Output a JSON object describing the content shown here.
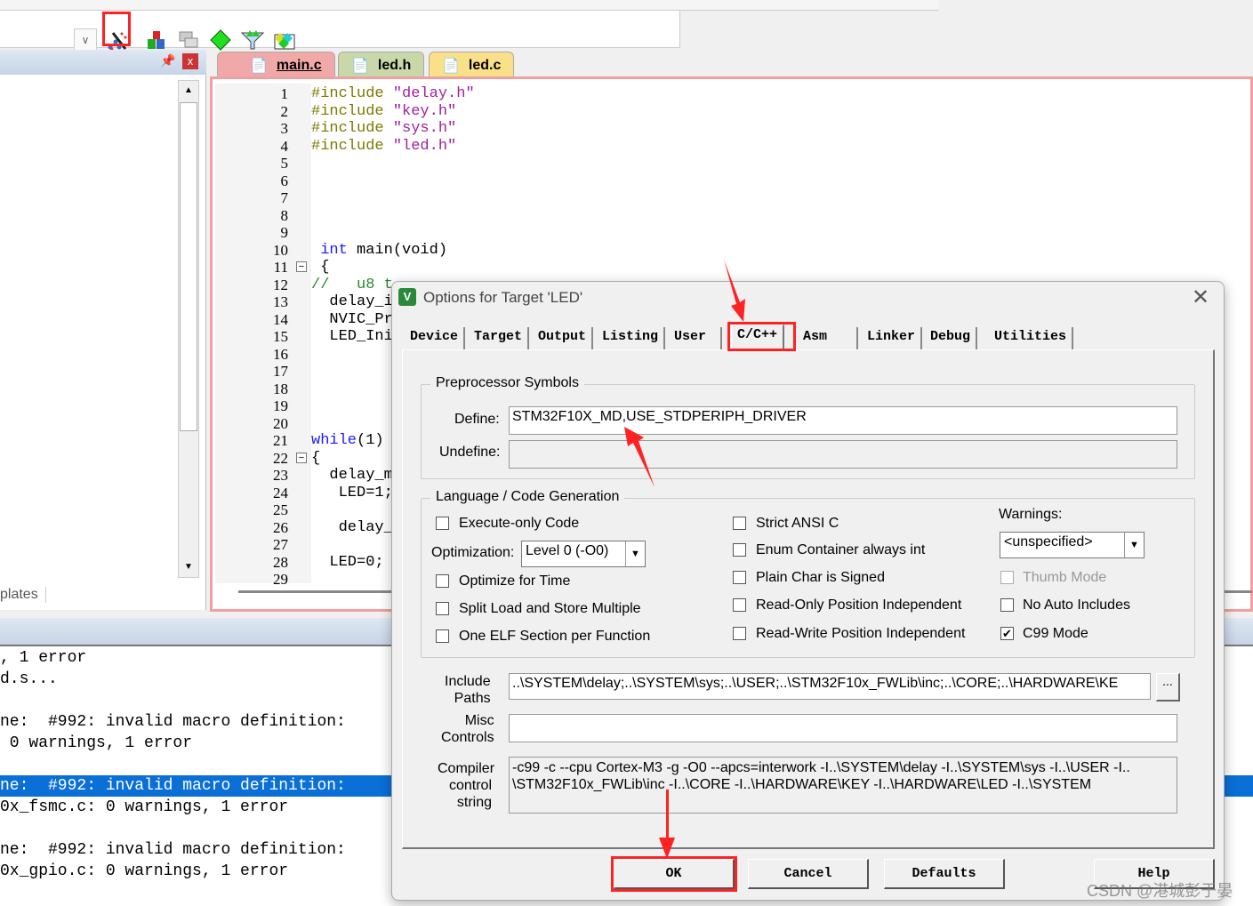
{
  "toolbar": {
    "icons": [
      "dropdown-chevron-icon",
      "options-for-target-icon",
      "manage-project-items-icon",
      "select-packs-icon",
      "pack-installer-icon",
      "run-time-environment-icon",
      "event-recorder-icon"
    ]
  },
  "left_pane": {
    "tab_label": "plates"
  },
  "file_tabs": [
    {
      "label": "main.c",
      "color": "#f1a8a8"
    },
    {
      "label": "led.h",
      "color": "#c8d8a8"
    },
    {
      "label": "led.c",
      "color": "#fbe08a"
    }
  ],
  "code": {
    "line_numbers": [
      "1",
      "2",
      "3",
      "4",
      "5",
      "6",
      "7",
      "8",
      "9",
      "10",
      "11",
      "12",
      "13",
      "14",
      "15",
      "16",
      "17",
      "18",
      "19",
      "20",
      "21",
      "22",
      "23",
      "24",
      "25",
      "26",
      "27",
      "28",
      "29"
    ],
    "lines": [
      {
        "n": 1,
        "kw": "#include ",
        "str": "\"delay.h\""
      },
      {
        "n": 2,
        "kw": "#include ",
        "str": "\"key.h\""
      },
      {
        "n": 3,
        "kw": "#include ",
        "str": "\"sys.h\""
      },
      {
        "n": 4,
        "kw": "#include ",
        "str": "\"led.h\""
      },
      {
        "n": 10,
        "kw": " int",
        "str": "",
        "rest": " main(void)"
      },
      {
        "n": 11,
        "rest": " {"
      },
      {
        "n": 12,
        "cm": "//   u8 t"
      },
      {
        "n": 13,
        "rest": "  delay_i"
      },
      {
        "n": 14,
        "rest": "  NVIC_Pr"
      },
      {
        "n": 15,
        "rest": "  LED_Ini"
      },
      {
        "n": 21,
        "kw": "while",
        "rest": "(1)"
      },
      {
        "n": 22,
        "rest": "{"
      },
      {
        "n": 23,
        "rest": "  delay_m"
      },
      {
        "n": 24,
        "rest": "   LED=1;"
      },
      {
        "n": 26,
        "rest": "   delay_"
      },
      {
        "n": 28,
        "rest": "  LED=0;"
      }
    ]
  },
  "output": {
    "lines": [
      ", 1 error",
      "d.s...",
      "",
      "ne:  #992: invalid macro definition:",
      " 0 warnings, 1 error",
      "",
      "ne:  #992: invalid macro definition:",
      "0x_fsmc.c: 0 warnings, 1 error",
      "",
      "ne:  #992: invalid macro definition:",
      "0x_gpio.c: 0 warnings, 1 error"
    ],
    "selected_index": 6
  },
  "dialog": {
    "title": "Options for Target 'LED'",
    "tabs": [
      "Device",
      "Target",
      "Output",
      "Listing",
      "User",
      "C/C++",
      "Asm",
      "Linker",
      "Debug",
      "Utilities"
    ],
    "active_tab": "C/C++",
    "preprocessor": {
      "group": "Preprocessor Symbols",
      "define_label": "Define:",
      "define_value": "STM32F10X_MD,USE_STDPERIPH_DRIVER",
      "undefine_label": "Undefine:",
      "undefine_value": ""
    },
    "language": {
      "group": "Language / Code Generation",
      "execute_only": {
        "label": "Execute-only Code",
        "checked": false
      },
      "optimization_label": "Optimization:",
      "optimization_value": "Level 0 (-O0)",
      "optimize_time": {
        "label": "Optimize for Time",
        "checked": false
      },
      "split_load": {
        "label": "Split Load and Store Multiple",
        "checked": false
      },
      "one_elf": {
        "label": "One ELF Section per Function",
        "checked": false
      },
      "strict_ansi": {
        "label": "Strict ANSI C",
        "checked": false
      },
      "enum_container": {
        "label": "Enum Container always int",
        "checked": false
      },
      "plain_char": {
        "label": "Plain Char is Signed",
        "checked": false
      },
      "ropi": {
        "label": "Read-Only Position Independent",
        "checked": false
      },
      "rwpi": {
        "label": "Read-Write Position Independent",
        "checked": false
      },
      "warnings_label": "Warnings:",
      "warnings_value": "<unspecified>",
      "thumb_mode": {
        "label": "Thumb Mode",
        "checked": false,
        "disabled": true
      },
      "no_auto_includes": {
        "label": "No Auto Includes",
        "checked": false
      },
      "c99_mode": {
        "label": "C99 Mode",
        "checked": true
      }
    },
    "include_paths": {
      "label_1": "Include",
      "label_2": "Paths",
      "value": "..\\SYSTEM\\delay;..\\SYSTEM\\sys;..\\USER;..\\STM32F10x_FWLib\\inc;..\\CORE;..\\HARDWARE\\KE",
      "browse": "..."
    },
    "misc_controls": {
      "label_1": "Misc",
      "label_2": "Controls",
      "value": ""
    },
    "compiler_string": {
      "label_1": "Compiler",
      "label_2": "control",
      "label_3": "string",
      "line_1": "-c99 -c --cpu Cortex-M3 -g -O0 --apcs=interwork -I..\\SYSTEM\\delay -I..\\SYSTEM\\sys -I..\\USER -I..",
      "line_2": "\\STM32F10x_FWLib\\inc -I..\\CORE -I..\\HARDWARE\\KEY -I..\\HARDWARE\\LED -I..\\SYSTEM"
    },
    "buttons": {
      "ok": "OK",
      "cancel": "Cancel",
      "defaults": "Defaults",
      "help": "Help"
    }
  },
  "watermark": "CSDN @港城彭于晏",
  "annotation_color": "#ff2020"
}
